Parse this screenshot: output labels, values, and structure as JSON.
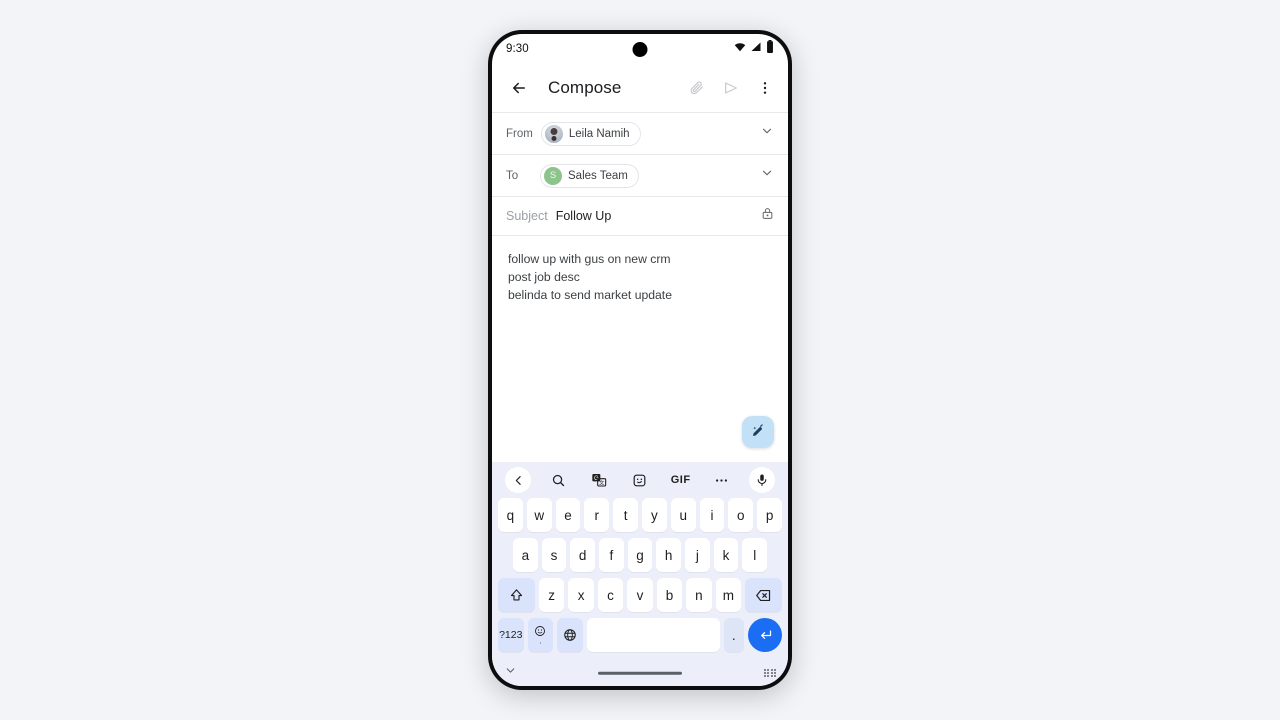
{
  "status_bar": {
    "time": "9:30",
    "icons": [
      "wifi-icon",
      "signal-icon",
      "battery-icon"
    ]
  },
  "app_bar": {
    "back_icon": "arrow-back-icon",
    "title": "Compose",
    "actions": [
      {
        "name": "attach-icon",
        "label": "Attach",
        "enabled": false
      },
      {
        "name": "send-icon",
        "label": "Send",
        "enabled": false
      },
      {
        "name": "more-options-icon",
        "label": "More options",
        "enabled": true
      }
    ]
  },
  "compose": {
    "from": {
      "label": "From",
      "chip": "Leila Namih",
      "avatar_type": "photo",
      "expand_icon": "chevron-down-icon"
    },
    "to": {
      "label": "To",
      "chip": "Sales Team",
      "avatar_letter": "S",
      "avatar_color": "#8cc48b",
      "expand_icon": "chevron-down-icon"
    },
    "subject": {
      "placeholder": "Subject",
      "value": "Follow Up",
      "lock_icon": "lock-icon"
    },
    "body_lines": [
      "follow up with gus on new crm",
      "post job desc",
      "belinda to send market update"
    ],
    "fab": {
      "name": "magic-compose-button",
      "icon": "magic-pen-icon",
      "color": "#c2e1f7"
    }
  },
  "keyboard": {
    "toolbar": [
      {
        "name": "toolbar-back-icon",
        "label": "‹"
      },
      {
        "name": "search-icon",
        "label": "search"
      },
      {
        "name": "translate-icon",
        "label": "translate"
      },
      {
        "name": "sticker-icon",
        "label": "sticker"
      },
      {
        "name": "gif-icon",
        "label": "GIF"
      },
      {
        "name": "more-icon",
        "label": "•••"
      },
      {
        "name": "microphone-icon",
        "label": "mic"
      }
    ],
    "row1": [
      "q",
      "w",
      "e",
      "r",
      "t",
      "y",
      "u",
      "i",
      "o",
      "p"
    ],
    "row2": [
      "a",
      "s",
      "d",
      "f",
      "g",
      "h",
      "j",
      "k",
      "l"
    ],
    "row3_letters": [
      "z",
      "x",
      "c",
      "v",
      "b",
      "n",
      "m"
    ],
    "shift_icon": "shift-icon",
    "backspace_icon": "backspace-icon",
    "row4": {
      "symbols_label": "?123",
      "emoji_icon": "emoji-icon",
      "emoji_sub": ",",
      "globe_icon": "globe-icon",
      "space_label": "",
      "period_label": ".",
      "enter_icon": "enter-icon",
      "enter_color": "#1b6ef3"
    }
  },
  "nav_bar": {
    "hide_keyboard_icon": "chevron-down-icon",
    "resize_handle_icon": "drag-handle-icon"
  }
}
